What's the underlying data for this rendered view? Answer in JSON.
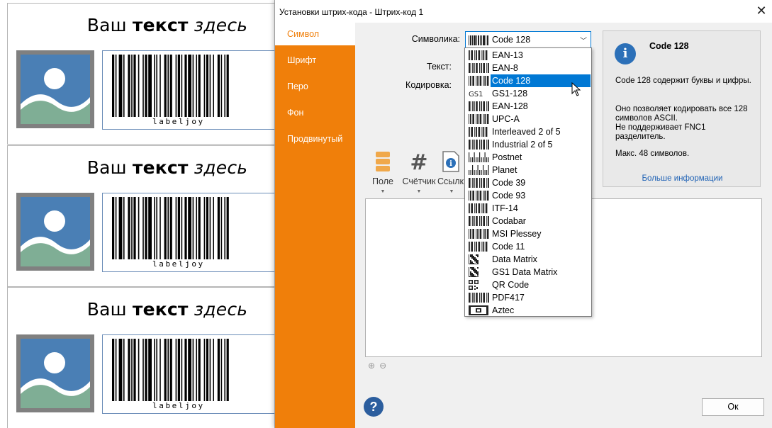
{
  "labels": {
    "title_plain": "Ваш",
    "title_bold": "текст",
    "title_italic": "здесь",
    "barcode_text": "labeljoy"
  },
  "dialog": {
    "title": "Установки штрих-кода - Штрих-код 1",
    "close_glyph": "✕"
  },
  "sidebar": {
    "items": [
      {
        "label": "Символ",
        "active": true
      },
      {
        "label": "Шрифт",
        "active": false
      },
      {
        "label": "Перо",
        "active": false
      },
      {
        "label": "Фон",
        "active": false
      },
      {
        "label": "Продвинутый",
        "active": false
      }
    ]
  },
  "form": {
    "symbology_label": "Символика:",
    "symbology_value": "Code 128",
    "text_label": "Текст:",
    "encoding_label": "Кодировка:"
  },
  "toolbar": {
    "field_label": "Поле",
    "counter_label": "Счётчик",
    "link_label": "Ссылк"
  },
  "info": {
    "title": "Code 128",
    "line1": "Code 128 содержит буквы и цифры.",
    "line2": "Оно позволяет кодировать все 128 символов ASCII.\nНе поддерживает FNC1 разделитель.",
    "line3": "Макс. 48 символов.",
    "more_link": "Больше информации"
  },
  "dropdown": {
    "options": [
      "EAN-13",
      "EAN-8",
      "Code 128",
      "GS1-128",
      "EAN-128",
      "UPC-A",
      "Interleaved 2 of 5",
      "Industrial 2 of 5",
      "Postnet",
      "Planet",
      "Code 39",
      "Code 93",
      "ITF-14",
      "Codabar",
      "MSI Plessey",
      "Code 11",
      "Data Matrix",
      "GS1 Data Matrix",
      "QR Code",
      "PDF417",
      "Aztec"
    ],
    "selected": "Code 128"
  },
  "buttons": {
    "ok_label": "Ок",
    "help_glyph": "?"
  },
  "colors": {
    "accent_orange": "#f07f0a",
    "selection_blue": "#0078d4",
    "info_blue": "#2c70b8"
  }
}
